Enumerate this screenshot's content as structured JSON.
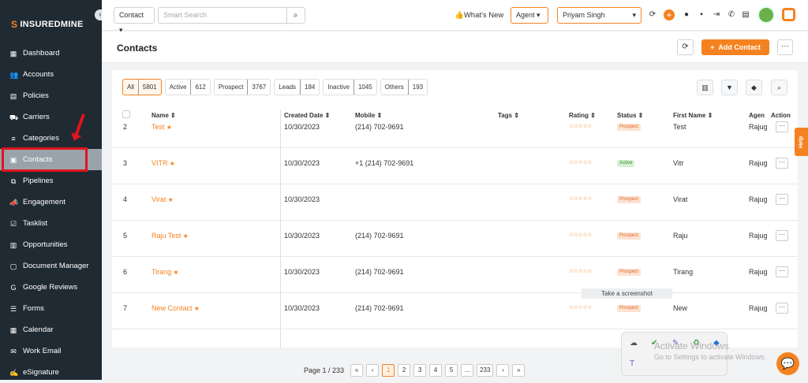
{
  "sidebar": {
    "logo": "INSUREDMINE",
    "items": [
      {
        "label": "Dashboard",
        "icon": "dashboard-icon"
      },
      {
        "label": "Accounts",
        "icon": "accounts-icon"
      },
      {
        "label": "Policies",
        "icon": "policies-icon"
      },
      {
        "label": "Carriers",
        "icon": "carriers-icon"
      },
      {
        "label": "Categories",
        "icon": "categories-icon"
      },
      {
        "label": "Contacts",
        "icon": "contacts-icon",
        "active": true
      },
      {
        "label": "Pipelines",
        "icon": "pipelines-icon"
      },
      {
        "label": "Engagement",
        "icon": "engagement-icon"
      },
      {
        "label": "Tasklist",
        "icon": "tasklist-icon"
      },
      {
        "label": "Opportunities",
        "icon": "opportunities-icon"
      },
      {
        "label": "Document Manager",
        "icon": "document-icon"
      },
      {
        "label": "Google Reviews",
        "icon": "google-icon"
      },
      {
        "label": "Forms",
        "icon": "forms-icon"
      },
      {
        "label": "Calendar",
        "icon": "calendar-icon"
      },
      {
        "label": "Work Email",
        "icon": "email-icon"
      },
      {
        "label": "eSignature",
        "icon": "signature-icon"
      }
    ]
  },
  "topbar": {
    "search_scope": "Contact",
    "search_placeholder": "Smart Search",
    "whats_new": "What's New",
    "role": "Agent",
    "user": "Priyam Singh"
  },
  "header": {
    "title": "Contacts",
    "add_label": "Add Contact"
  },
  "filters": [
    {
      "label": "All",
      "count": "5801",
      "active": true
    },
    {
      "label": "Active",
      "count": "612"
    },
    {
      "label": "Prospect",
      "count": "3767"
    },
    {
      "label": "Leads",
      "count": "184"
    },
    {
      "label": "Inactive",
      "count": "1045"
    },
    {
      "label": "Others",
      "count": "193"
    }
  ],
  "table": {
    "columns": [
      "Name",
      "Created Date",
      "Mobile",
      "Tags",
      "Rating",
      "Status",
      "First Name",
      "Agent",
      "Action"
    ],
    "rows": [
      {
        "num": "2",
        "name": "Test",
        "date": "10/30/2023",
        "mobile": "(214) 702-9691",
        "status": "Prospect",
        "first": "Test",
        "agent": "Rajug"
      },
      {
        "num": "3",
        "name": "VITR",
        "date": "10/30/2023",
        "mobile": "+1 (214) 702-9691",
        "status": "Active",
        "first": "Vitr",
        "agent": "Rajug"
      },
      {
        "num": "4",
        "name": "Virat",
        "date": "10/30/2023",
        "mobile": "",
        "status": "Prospect",
        "first": "Virat",
        "agent": "Rajug"
      },
      {
        "num": "5",
        "name": "Raju Test",
        "date": "10/30/2023",
        "mobile": "(214) 702-9691",
        "status": "Prospect",
        "first": "Raju",
        "agent": "Rajug"
      },
      {
        "num": "6",
        "name": "Tirang",
        "date": "10/30/2023",
        "mobile": "(214) 702-9691",
        "status": "Prospect",
        "first": "Tirang",
        "agent": "Rajug"
      },
      {
        "num": "7",
        "name": "New Contact",
        "date": "10/30/2023",
        "mobile": "(214) 702-9691",
        "status": "Prospect",
        "first": "New",
        "agent": "Rajug"
      }
    ]
  },
  "pager": {
    "label": "Page 1 / 233",
    "pages": [
      "«",
      "‹",
      "1",
      "2",
      "3",
      "4",
      "5",
      "...",
      "233",
      "›",
      "»"
    ]
  },
  "tooltip": "Take a screenshot",
  "help": "Help",
  "activate": {
    "title": "Activate Windows",
    "sub": "Go to Settings to activate Windows."
  }
}
